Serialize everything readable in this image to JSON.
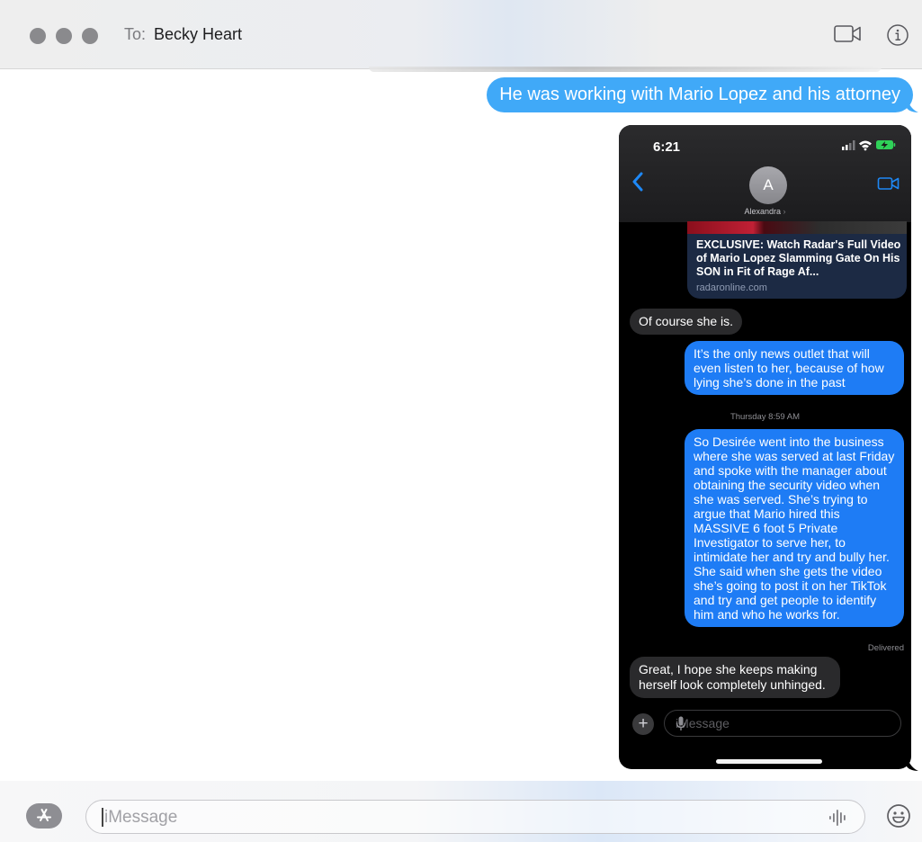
{
  "window": {
    "traffic_lights": [
      "close",
      "minimize",
      "zoom"
    ],
    "to_label": "To:",
    "recipient": "Becky Heart",
    "icons": [
      "video-camera-icon",
      "info-icon"
    ]
  },
  "conversation": {
    "outgoing_message": "He was working with Mario Lopez and his attorney"
  },
  "phone_screenshot": {
    "status_time": "6:21",
    "contact_initial": "A",
    "contact_name": "Alexandra",
    "contact_chevron": "›",
    "link_preview": {
      "title": "EXCLUSIVE: Watch Radar's Full Video of Mario Lopez Slamming Gate On His SON in Fit of Rage Af...",
      "site": "radaronline.com"
    },
    "messages": [
      {
        "direction": "incoming",
        "text": "Of course she is."
      },
      {
        "direction": "outgoing",
        "text": "It’s the only news outlet that will even listen to her, because of how lying she’s done in the past"
      },
      {
        "direction": "outgoing",
        "text": "So Desirée went into the business where she was served at last Friday and spoke with the manager about obtaining the security video when she was served. She’s trying to argue that Mario hired this MASSIVE 6 foot 5 Private Investigator to serve her, to intimidate her and try and bully her. She said when she gets the video she’s going to post it on her TikTok and try and get people to identify him and who he works for."
      },
      {
        "direction": "incoming",
        "text": "Great, I hope she keeps making herself look completely unhinged."
      }
    ],
    "timestamp_label": "Thursday 8:59 AM",
    "delivered_label": "Delivered",
    "input_placeholder": "iMessage",
    "plus_symbol": "+"
  },
  "composer": {
    "placeholder": "iMessage",
    "value": "",
    "icons": [
      "app-store-icon",
      "audio-waveform-icon",
      "emoji-icon"
    ]
  }
}
